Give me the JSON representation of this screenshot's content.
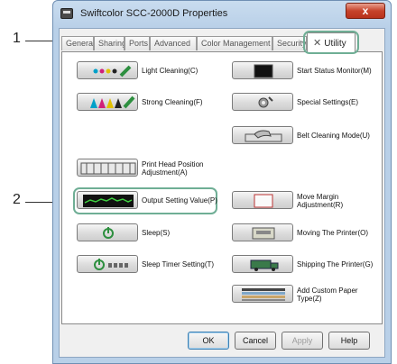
{
  "callouts": {
    "one": "1",
    "two": "2"
  },
  "window": {
    "title": "Swiftcolor SCC-2000D Properties",
    "close_label": "x"
  },
  "tabs": [
    {
      "label": "General"
    },
    {
      "label": "Sharing"
    },
    {
      "label": "Ports"
    },
    {
      "label": "Advanced"
    },
    {
      "label": "Color Management"
    },
    {
      "label": "Security"
    }
  ],
  "active_tab": {
    "label": "Utility",
    "icon": "wrench-screwdriver-icon"
  },
  "left_items": [
    {
      "label": "Light Cleaning(C)",
      "icon": "light-cleaning-icon"
    },
    {
      "label": "Strong Cleaning(F)",
      "icon": "strong-cleaning-icon"
    },
    {
      "label": "Print Head Position Adjustment(A)",
      "icon": "head-position-icon"
    },
    {
      "label": "Output Setting Value(P)",
      "icon": "output-setting-icon"
    },
    {
      "label": "Sleep(S)",
      "icon": "power-icon"
    },
    {
      "label": "Sleep Timer Setting(T)",
      "icon": "sleep-timer-icon"
    }
  ],
  "right_items": [
    {
      "label": "Start Status Monitor(M)",
      "icon": "status-monitor-icon"
    },
    {
      "label": "Special Settings(E)",
      "icon": "special-settings-icon"
    },
    {
      "label": "Belt Cleaning Mode(U)",
      "icon": "belt-cleaning-icon"
    },
    {
      "label": "Move Margin Adjustment(R)",
      "icon": "margin-adjust-icon"
    },
    {
      "label": "Moving The Printer(O)",
      "icon": "moving-printer-icon"
    },
    {
      "label": "Shipping The Printer(G)",
      "icon": "shipping-printer-icon"
    },
    {
      "label": "Add Custom Paper Type(Z)",
      "icon": "custom-paper-icon"
    }
  ],
  "buttons": {
    "ok": "OK",
    "cancel": "Cancel",
    "apply": "Apply",
    "help": "Help"
  },
  "colors": {
    "highlight": "#6fae95",
    "titlebar": "#b9d0e8",
    "close": "#c7432b"
  }
}
